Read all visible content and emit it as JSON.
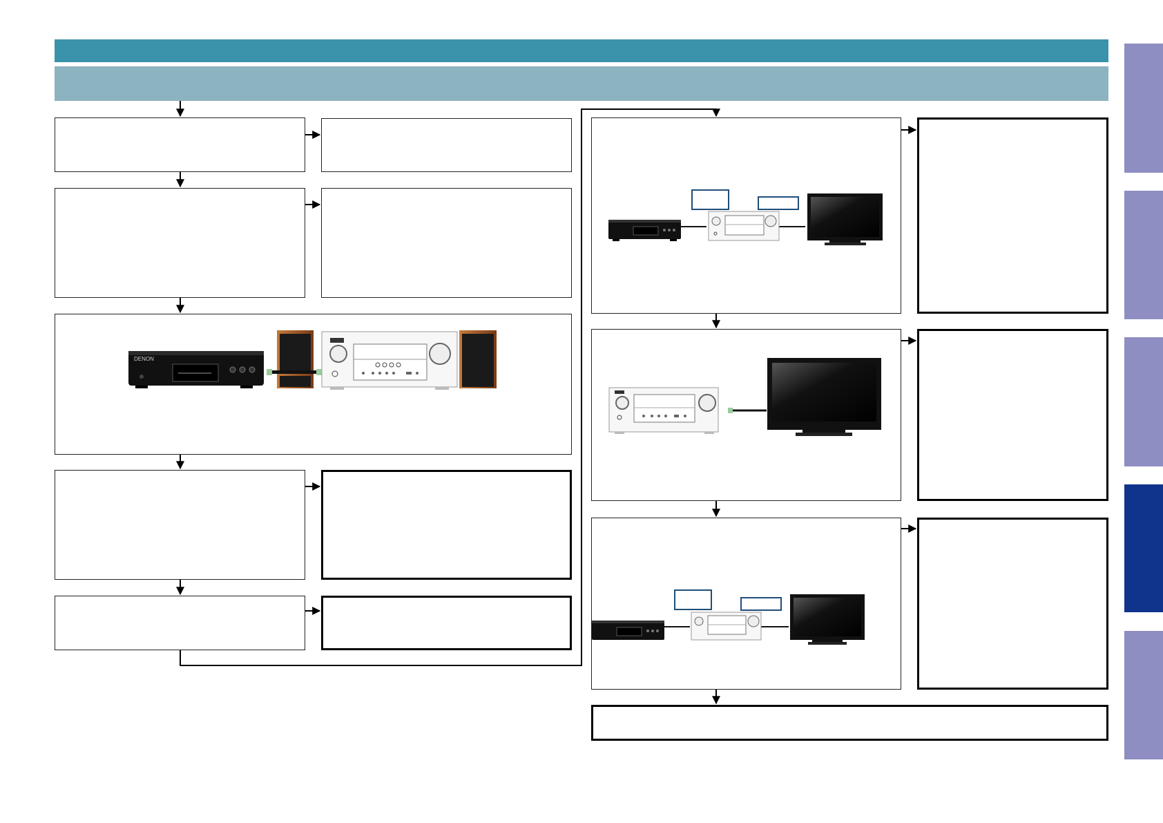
{
  "colors": {
    "banner_primary": "#3a93aa",
    "banner_secondary": "#8cb3c0",
    "tab_inactive": "#8e8ec2",
    "tab_active": "#10348c",
    "speaker_wood": "#a55a2a",
    "device_black": "#111111",
    "label_frame": "#1f4e79"
  },
  "side_tabs": [
    {
      "state": "inactive"
    },
    {
      "state": "inactive"
    },
    {
      "state": "inactive"
    },
    {
      "state": "active"
    },
    {
      "state": "inactive"
    }
  ],
  "device_labels": {
    "player": "DENON",
    "receiver": "DENON"
  },
  "icons": [
    "cd-player-icon",
    "speaker-icon",
    "av-receiver-icon",
    "television-icon",
    "hdmi-cable-icon",
    "flow-arrow-icon"
  ]
}
